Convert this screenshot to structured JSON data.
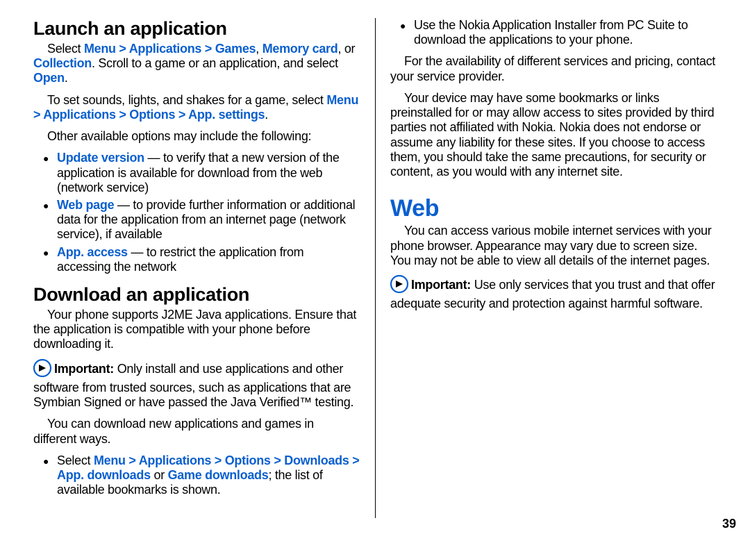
{
  "sec1": {
    "title": "Launch an application",
    "p1_a": "Select ",
    "p1_menu": "Menu",
    "gt": " > ",
    "apps": "Applications",
    "games": "Games",
    "comma": ", ",
    "memcard": "Memory card",
    "p1_b": ", or ",
    "collection": "Collection",
    "p1_c": ". Scroll to a game or an application, and select ",
    "open": "Open",
    "dot": ".",
    "p2_a": "To set sounds, lights, and shakes for a game, select ",
    "options": "Options",
    "appsettings": "App. settings",
    "p3": "Other available options may include the following:",
    "li1_a": "Update version",
    "li1_b": "  — to verify that a new version of the application is available for download from the web (network service)",
    "li2_a": "Web page",
    "li2_b": " — to provide further information or additional data for the application from an internet page (network service), if available",
    "li3_a": "App. access",
    "li3_b": " —  to restrict the application from accessing the network"
  },
  "sec2": {
    "title": "Download an application",
    "p1": "Your phone supports J2ME Java applications. Ensure that the application is compatible with your phone before downloading it.",
    "imp_label": "Important:  ",
    "imp_text": "Only install and use applications and other software from trusted sources, such as applications that are Symbian Signed or have passed the Java Verified™ testing.",
    "p2": "You can download new applications and games in different ways.",
    "li1_a": "Select ",
    "downloads": "Downloads",
    "appdl": "App. downloads",
    "or": " or ",
    "gamedl": "Game downloads",
    "li1_b": "; the list of available bookmarks is shown.",
    "li2": "Use the Nokia Application Installer from PC Suite to download the applications to your phone.",
    "p3": "For the availability of different services and pricing, contact your service provider.",
    "p4": "Your device may have some bookmarks or links preinstalled for or may allow access to sites provided by third parties not affiliated with Nokia. Nokia does not endorse or assume any liability for these sites. If you choose to access them, you should take the same precautions, for security or content, as you would with any internet site."
  },
  "sec3": {
    "title": "Web",
    "p1": "You can access various mobile internet services with your phone browser. Appearance may vary due to screen size. You may not be able to view all details of the internet pages.",
    "imp_label": "Important:  ",
    "imp_text": "Use only services that you trust and that offer adequate security and protection against harmful software."
  },
  "page_number": "39"
}
